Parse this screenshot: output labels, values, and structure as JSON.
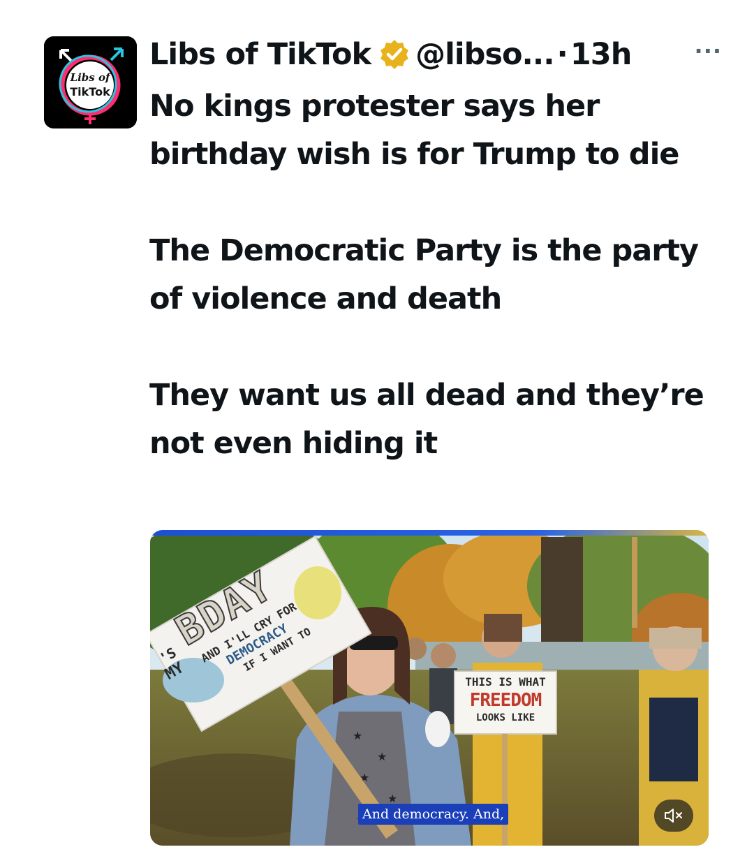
{
  "author": {
    "display_name": "Libs of TikTok",
    "handle": "@libso...",
    "separator": "·",
    "time": "13h",
    "avatar_text_line1": "Libs of",
    "avatar_text_line2": "TikTok",
    "verified_icon": "verified-gold-badge-icon"
  },
  "more_icon": "···",
  "tweet": {
    "paragraphs": [
      "No kings protester says her birthday wish is for Trump to die",
      "The Democratic Party is the party of violence and death",
      "They want us all dead and they’re not even hiding it"
    ]
  },
  "video": {
    "sign_left": {
      "line_its": "'S",
      "line_my": "MY",
      "line_bday": "BDAY",
      "line_cry": "AND I'LL CRY FOR",
      "line_democracy": "DEMOCRACY",
      "line_want": "IF I WANT TO"
    },
    "sign_right": {
      "line1": "THIS IS WHAT",
      "line2": "FREEDOM",
      "line3": "LOOKS LIKE"
    },
    "caption": "And democracy. And,",
    "mute_icon": "speaker-muted-icon"
  },
  "colors": {
    "text": "#0f1419",
    "verified": "#e8b21c",
    "caption_bg": "#1a3fb8",
    "freedom_red": "#c0392b",
    "freedom_blue": "#2d5fb3"
  }
}
